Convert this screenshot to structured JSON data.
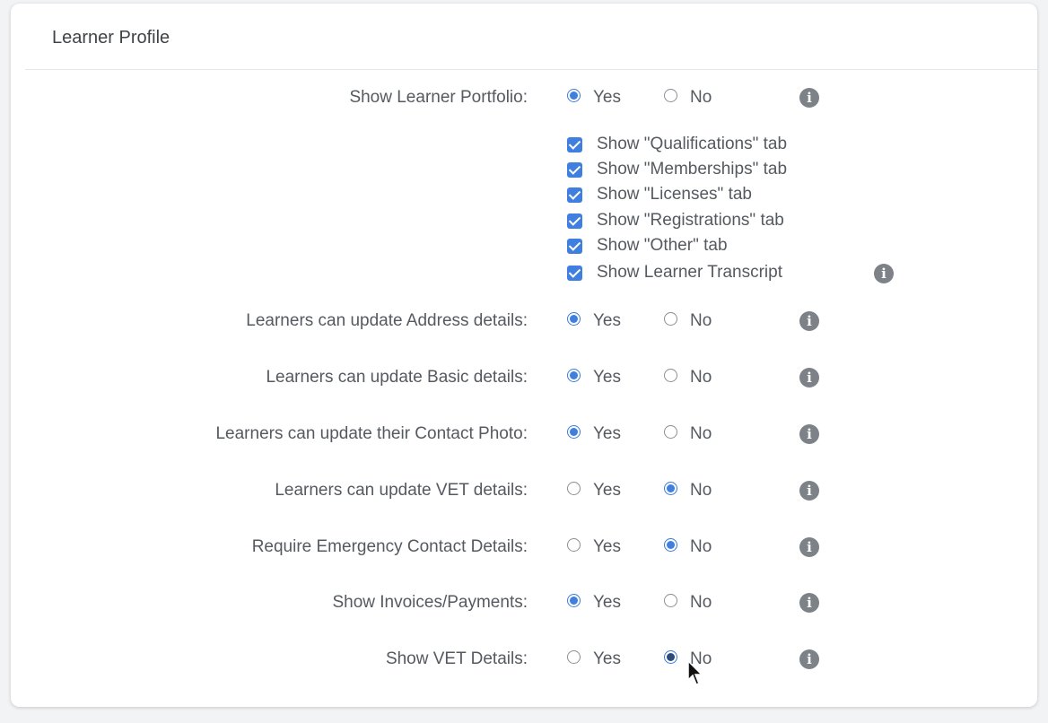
{
  "panel": {
    "title": "Learner Profile"
  },
  "options": {
    "yes": "Yes",
    "no": "No"
  },
  "settings": [
    {
      "label": "Show Learner Portfolio:",
      "selected": "Yes"
    },
    {
      "label": "Learners can update Address details:",
      "selected": "Yes"
    },
    {
      "label": "Learners can update Basic details:",
      "selected": "Yes"
    },
    {
      "label": "Learners can update their Contact Photo:",
      "selected": "Yes"
    },
    {
      "label": "Learners can update VET details:",
      "selected": "No"
    },
    {
      "label": "Require Emergency Contact Details:",
      "selected": "No"
    },
    {
      "label": "Show Invoices/Payments:",
      "selected": "Yes"
    },
    {
      "label": "Show VET Details:",
      "selected": "No"
    }
  ],
  "portfolio_tabs": [
    {
      "label": "Show \"Qualifications\" tab",
      "checked": true
    },
    {
      "label": "Show \"Memberships\" tab",
      "checked": true
    },
    {
      "label": "Show \"Licenses\" tab",
      "checked": true
    },
    {
      "label": "Show \"Registrations\" tab",
      "checked": true
    },
    {
      "label": "Show \"Other\" tab",
      "checked": true
    },
    {
      "label": "Show Learner Transcript",
      "checked": true
    }
  ],
  "colors": {
    "accent": "#3f7fe0",
    "info_icon": "#7d8288"
  }
}
